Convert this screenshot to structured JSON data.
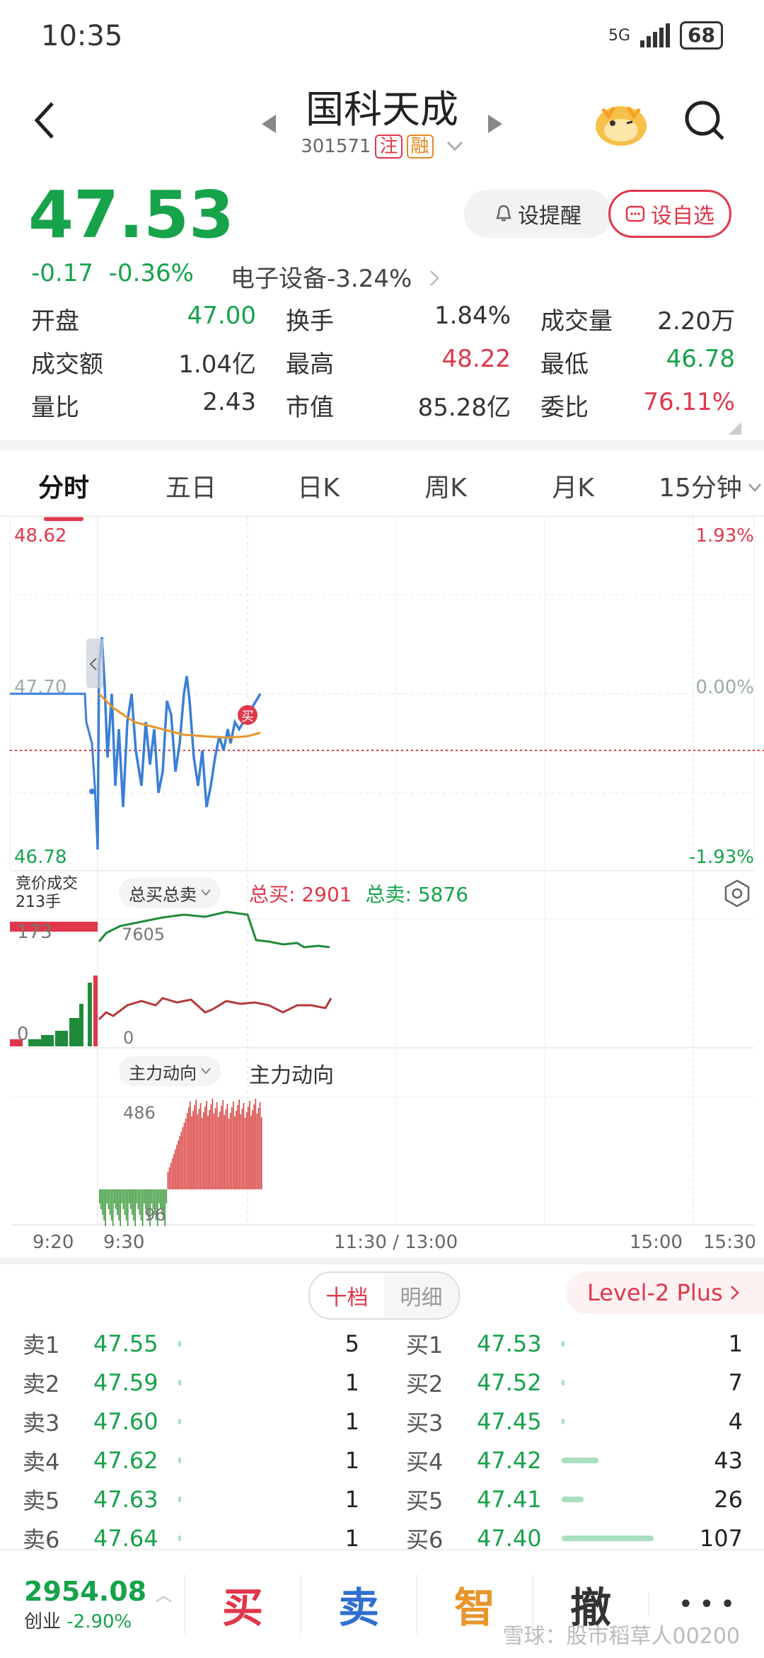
{
  "status": {
    "time": "10:35",
    "network": "5G",
    "battery": "68"
  },
  "header": {
    "title": "国科天成",
    "code": "301571",
    "tag1": "注",
    "tag2": "融",
    "back_icon": "back-arrow-icon",
    "search_icon": "search-icon"
  },
  "quote": {
    "price": "47.53",
    "change": "-0.17",
    "change_pct": "-0.36%",
    "sector": "电子设备",
    "sector_pct": "-3.24%",
    "alert_label": "设提醒",
    "fav_label": "设自选"
  },
  "stats": [
    [
      {
        "k": "开盘",
        "v": "47.00",
        "c": "green"
      },
      {
        "k": "换手",
        "v": "1.84%",
        "c": "dark"
      },
      {
        "k": "成交量",
        "v": "2.20万",
        "c": "dark"
      }
    ],
    [
      {
        "k": "成交额",
        "v": "1.04亿",
        "c": "dark"
      },
      {
        "k": "最高",
        "v": "48.22",
        "c": "red"
      },
      {
        "k": "最低",
        "v": "46.78",
        "c": "green"
      }
    ],
    [
      {
        "k": "量比",
        "v": "2.43",
        "c": "dark"
      },
      {
        "k": "市值",
        "v": "85.28亿",
        "c": "dark"
      },
      {
        "k": "委比",
        "v": "76.11%",
        "c": "red"
      }
    ]
  ],
  "tabs": [
    "分时",
    "五日",
    "日K",
    "周K",
    "月K",
    "15分钟"
  ],
  "chart": {
    "price_high": "48.62",
    "price_mid": "47.70",
    "price_low": "46.78",
    "pct_high": "1.93%",
    "pct_mid": "0.00%",
    "pct_low": "-1.93%",
    "buy_marker": "买",
    "auction_label": "竞价成交",
    "auction_vol": "213手",
    "panel1_select": "总买总卖",
    "total_buy_label": "总买:",
    "total_buy": "2901",
    "total_sell_label": "总卖:",
    "total_sell": "5876",
    "panel1_left_top": "173",
    "panel1_left_bottom": "0",
    "panel1_top": "7605",
    "panel1_bottom": "0",
    "panel2_select": "主力动向",
    "panel2_title": "主力动向",
    "panel2_top": "486",
    "panel2_bottom": "96",
    "times": [
      "9:20",
      "9:30",
      "11:30 / 13:00",
      "15:00",
      "15:30"
    ]
  },
  "orderbook": {
    "toggle": [
      "十档",
      "明细"
    ],
    "level2": "Level-2 Plus",
    "asks": [
      {
        "lab": "卖1",
        "pr": "47.55",
        "vol": "5",
        "bar": 0
      },
      {
        "lab": "卖2",
        "pr": "47.59",
        "vol": "1",
        "bar": 0
      },
      {
        "lab": "卖3",
        "pr": "47.60",
        "vol": "1",
        "bar": 0
      },
      {
        "lab": "卖4",
        "pr": "47.62",
        "vol": "1",
        "bar": 0
      },
      {
        "lab": "卖5",
        "pr": "47.63",
        "vol": "1",
        "bar": 0
      },
      {
        "lab": "卖6",
        "pr": "47.64",
        "vol": "1",
        "bar": 0
      }
    ],
    "bids": [
      {
        "lab": "买1",
        "pr": "47.53",
        "vol": "1",
        "bar": 0
      },
      {
        "lab": "买2",
        "pr": "47.52",
        "vol": "7",
        "bar": 0.03
      },
      {
        "lab": "买3",
        "pr": "47.45",
        "vol": "4",
        "bar": 0.02
      },
      {
        "lab": "买4",
        "pr": "47.42",
        "vol": "43",
        "bar": 0.4
      },
      {
        "lab": "买5",
        "pr": "47.41",
        "vol": "26",
        "bar": 0.24
      },
      {
        "lab": "买6",
        "pr": "47.40",
        "vol": "107",
        "bar": 1.0
      }
    ]
  },
  "bottom": {
    "index_val": "2954.08",
    "index_name": "创业",
    "index_pct": "-2.90%",
    "buy": "买",
    "sell": "卖",
    "smart": "智",
    "cancel": "撤",
    "more": "• • •",
    "watermark": "雪球：股市稻草人00200"
  }
}
